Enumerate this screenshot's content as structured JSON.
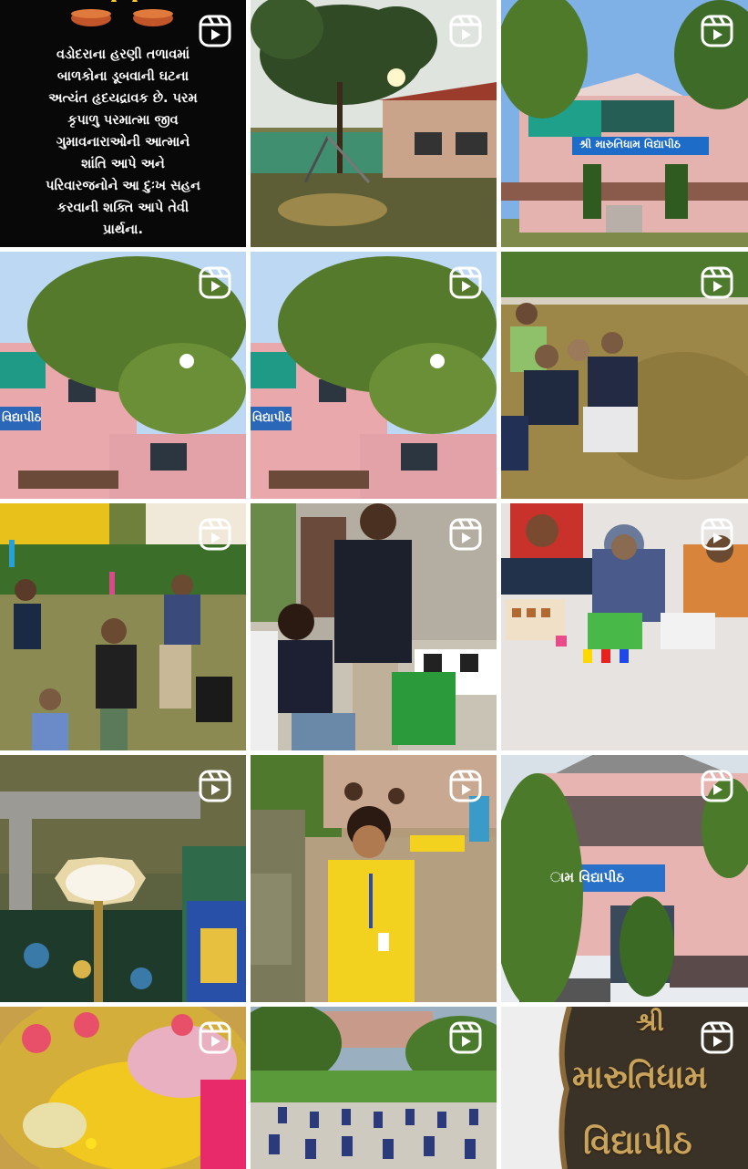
{
  "grid": {
    "tiles": [
      {
        "name": "prayer-message-post",
        "type": "reel",
        "text": "વડોદરાના હરણી તળાવમાં\nબાળકોના ડૂબવાની ઘટના\nઅત્યંત હૃદયદ્રાવક છે. પરમ\nકૃપાળુ પરમાત્મા જીવ\nગુમાવનારાઓની આત્માને\nશાંતિ આપે અને\nપરિવારજનોને આ દુઃખ સહન\nકરવાની શક્તિ આપે તેવી\nપ્રાર્થના."
      },
      {
        "name": "playground-sunrise-reel",
        "type": "reel"
      },
      {
        "name": "school-building-reel",
        "type": "reel",
        "sign": "શ્રી મારુતિધામ વિદ્યાપીઠ"
      },
      {
        "name": "school-tree-reel-1",
        "type": "reel",
        "sign": "વિદ્યાપીઠ"
      },
      {
        "name": "school-tree-reel-2",
        "type": "reel",
        "sign": "વિદ્યાપીઠ"
      },
      {
        "name": "students-on-grass-reel",
        "type": "reel"
      },
      {
        "name": "students-with-bottles-reel",
        "type": "reel"
      },
      {
        "name": "boy-with-microphone-reel",
        "type": "reel"
      },
      {
        "name": "kids-with-blocks-reel",
        "type": "reel"
      },
      {
        "name": "diya-lamp-reel",
        "type": "reel"
      },
      {
        "name": "boy-dancing-yellow-reel",
        "type": "reel"
      },
      {
        "name": "school-facade-reel",
        "type": "reel",
        "sign": "ામ વિદ્યાપીઠ"
      },
      {
        "name": "colors-rangoli-reel",
        "type": "reel"
      },
      {
        "name": "yoga-assembly-reel",
        "type": "reel"
      },
      {
        "name": "stone-nameplate-reel",
        "type": "reel",
        "lines": [
          "શ્રી",
          "મારુતિધામ",
          "વિદ્યાપીઠ"
        ]
      }
    ]
  },
  "icons": {
    "reel": "reel-icon"
  },
  "colors": {
    "icon": "#ffffff",
    "background": "#ffffff"
  }
}
